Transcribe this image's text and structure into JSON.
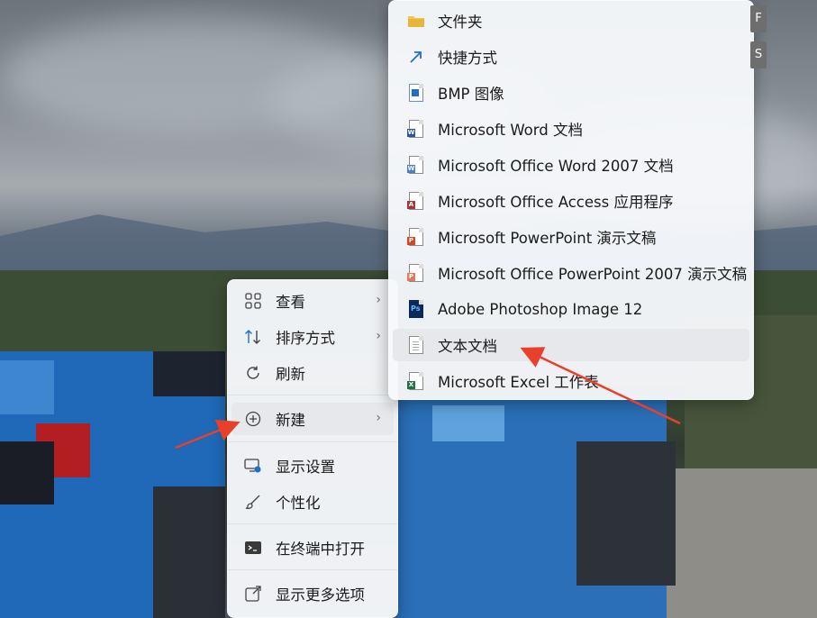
{
  "main_menu": {
    "items": [
      {
        "label": "查看",
        "icon": "grid-icon",
        "has_submenu": true
      },
      {
        "label": "排序方式",
        "icon": "sort-icon",
        "has_submenu": true
      },
      {
        "label": "刷新",
        "icon": "refresh-icon",
        "has_submenu": false
      },
      {
        "label": "新建",
        "icon": "new-plus-icon",
        "has_submenu": true
      },
      {
        "label": "显示设置",
        "icon": "display-settings-icon",
        "has_submenu": false
      },
      {
        "label": "个性化",
        "icon": "brush-icon",
        "has_submenu": false
      },
      {
        "label": "在终端中打开",
        "icon": "terminal-icon",
        "has_submenu": false
      },
      {
        "label": "显示更多选项",
        "icon": "share-icon",
        "has_submenu": false
      }
    ],
    "chevron": "›"
  },
  "sub_menu": {
    "items": [
      {
        "label": "文件夹",
        "icon": "folder-icon",
        "accent": "#e9b43a"
      },
      {
        "label": "快捷方式",
        "icon": "shortcut-arrow-icon",
        "accent": "#1e6fc9"
      },
      {
        "label": "BMP 图像",
        "icon": "bmp-image-icon",
        "accent": "#1e6fc9"
      },
      {
        "label": "Microsoft Word 文档",
        "icon": "word-doc-icon",
        "accent": "#2b579a"
      },
      {
        "label": "Microsoft Office Word 2007 文档",
        "icon": "word-2007-icon",
        "accent": "#2b579a"
      },
      {
        "label": "Microsoft Office Access 应用程序",
        "icon": "access-icon",
        "accent": "#a4373a"
      },
      {
        "label": "Microsoft PowerPoint 演示文稿",
        "icon": "powerpoint-icon",
        "accent": "#d24726"
      },
      {
        "label": "Microsoft Office PowerPoint 2007 演示文稿",
        "icon": "powerpoint-2007-icon",
        "accent": "#e07a5f"
      },
      {
        "label": "Adobe Photoshop Image 12",
        "icon": "photoshop-icon",
        "accent": "#0b2a5c"
      },
      {
        "label": "文本文档",
        "icon": "text-doc-icon",
        "accent": "#9a9a9a"
      },
      {
        "label": "Microsoft Excel 工作表",
        "icon": "excel-icon",
        "accent": "#217346"
      }
    ]
  },
  "access_keys": [
    "F",
    "S"
  ],
  "colors": {
    "annotation_arrow": "#e8402a",
    "menu_bg": "#f6f8fb",
    "highlight": "#e6e8ec"
  }
}
